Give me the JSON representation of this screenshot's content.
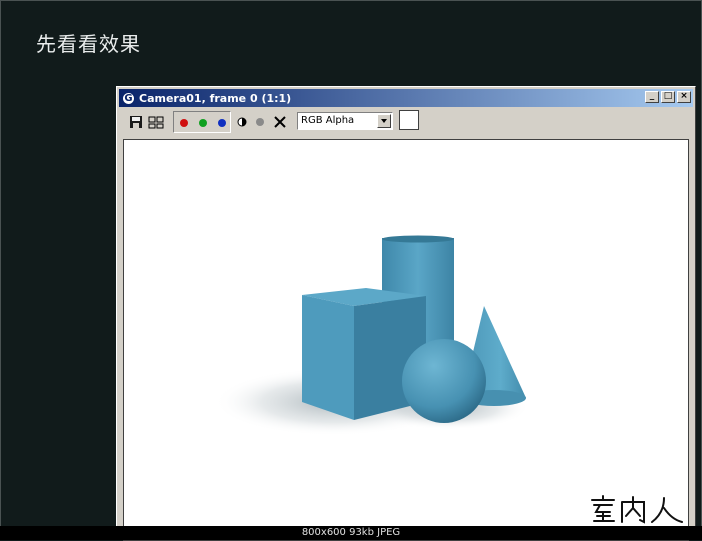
{
  "slide": {
    "title": "先看看效果"
  },
  "window": {
    "title": "Camera01, frame 0 (1:1)",
    "app_icon_glyph": "G",
    "minimize_glyph": "_",
    "maximize_glyph": "□",
    "close_glyph": "×"
  },
  "toolbar": {
    "channel_select": "RGB Alpha",
    "channels": [
      {
        "name": "red",
        "color": "#d01010"
      },
      {
        "name": "green",
        "color": "#10a020"
      },
      {
        "name": "blue",
        "color": "#1030c0"
      }
    ],
    "icons": [
      "save-icon",
      "clone-icon",
      "mono-icon",
      "alpha-icon",
      "clear-icon"
    ]
  },
  "render": {
    "objects": [
      "cube",
      "cylinder",
      "sphere",
      "cone"
    ],
    "object_color": "#4b97b8"
  },
  "status_bar": {
    "text": "800x600  93kb  JPEG"
  },
  "watermark": {
    "text": "室内人"
  }
}
